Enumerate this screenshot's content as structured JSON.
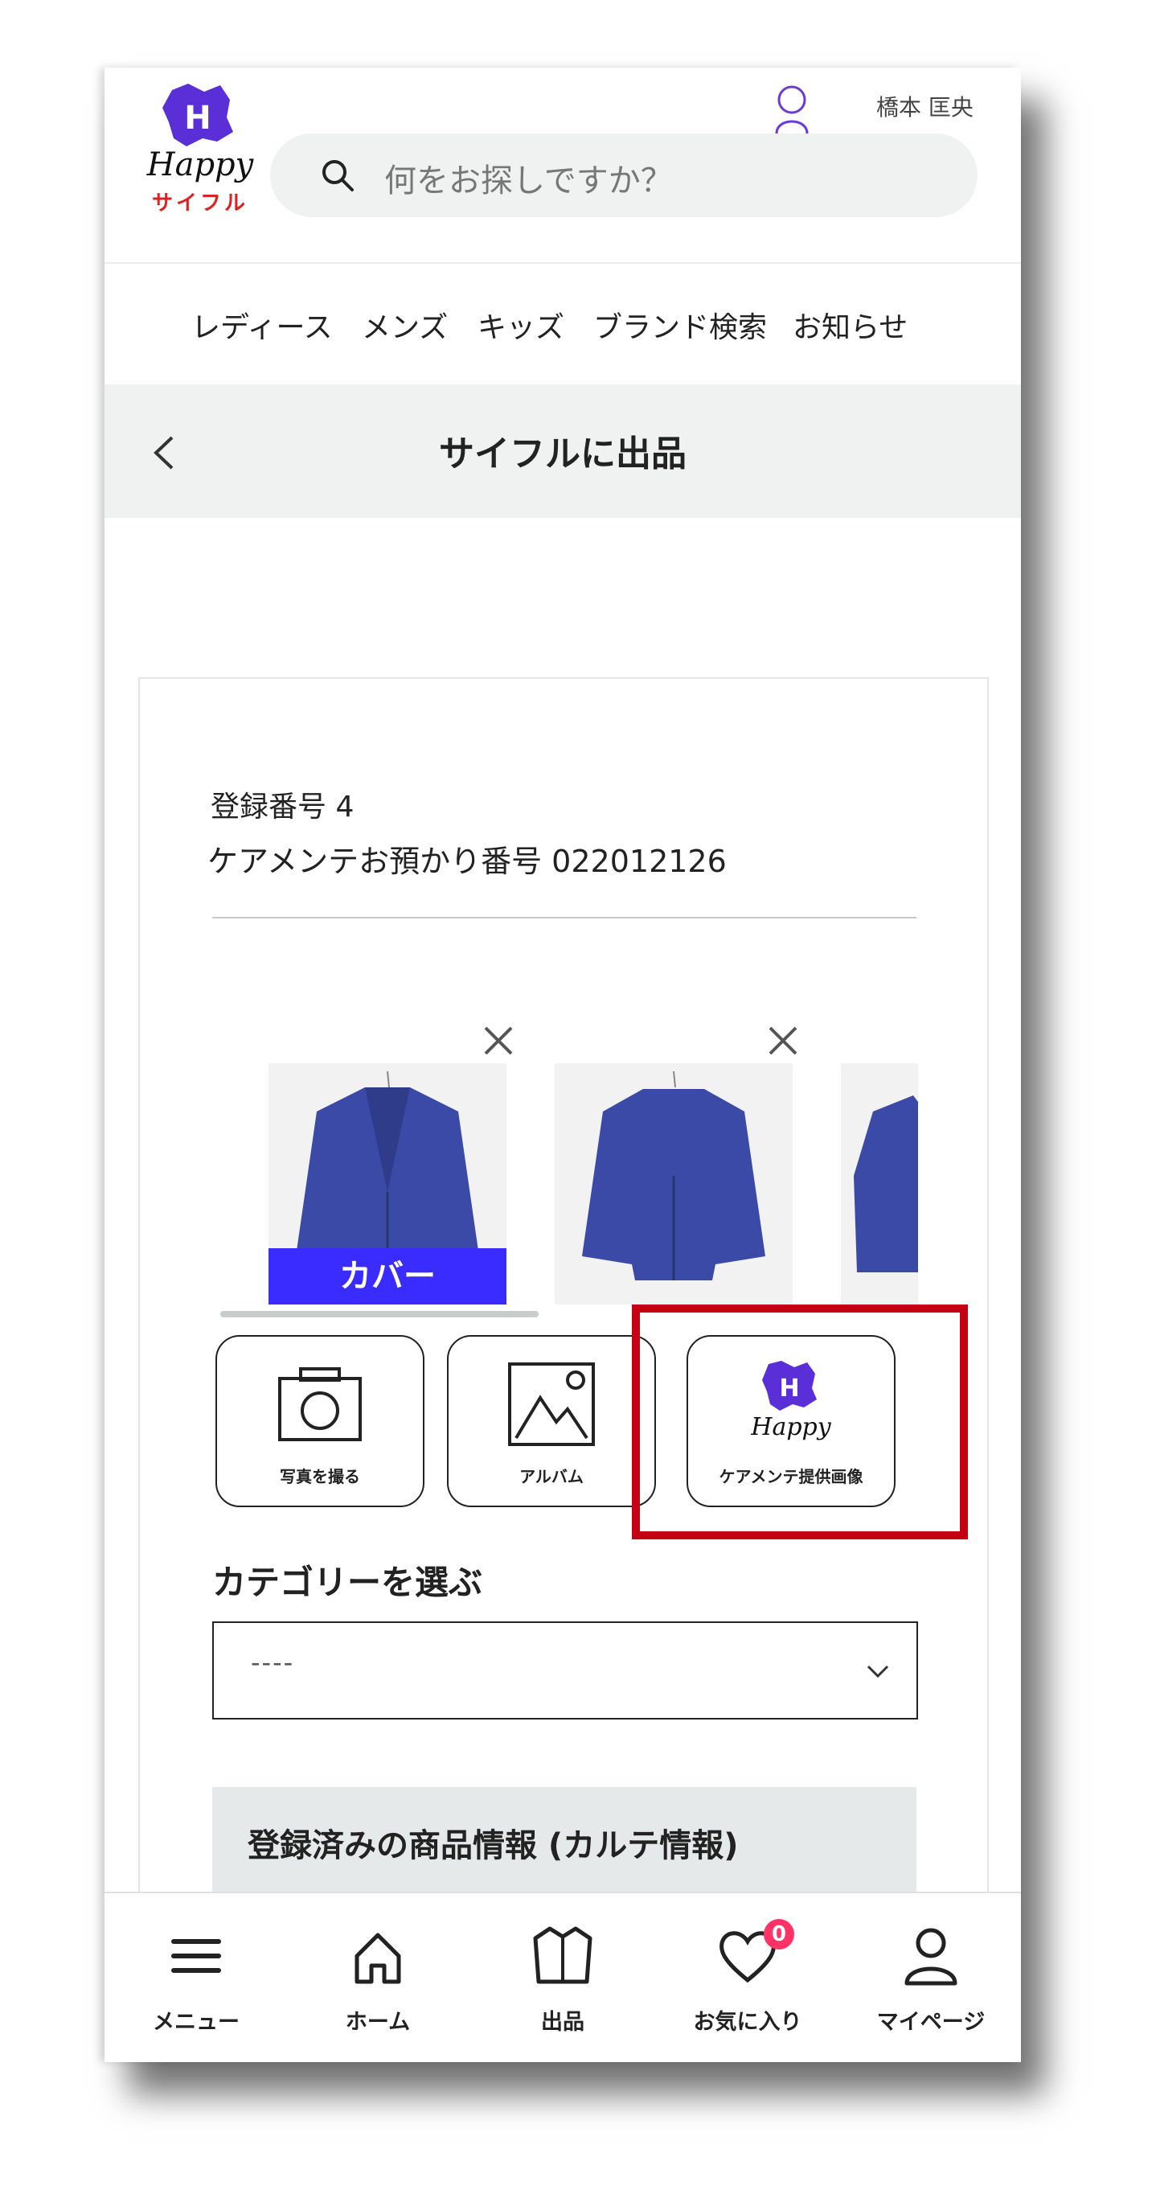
{
  "header": {
    "logo_happy": "Happy",
    "logo_saifuru": "サイフル",
    "user_name": "橋本 匡央",
    "search_placeholder": "何をお探しですか？"
  },
  "nav": {
    "items": [
      "レディース",
      "メンズ",
      "キッズ",
      "ブランド検索",
      "お知らせ"
    ]
  },
  "titlebar": {
    "title": "サイフルに出品"
  },
  "listing": {
    "registration": "登録番号 4",
    "care_number": "ケアメンテお預かり番号 022012126",
    "cover_label": "カバー",
    "buttons": {
      "camera": "写真を撮る",
      "album": "アルバム",
      "caremente": "ケアメンテ提供画像"
    },
    "category_heading": "カテゴリーを選ぶ",
    "category_value": "----",
    "info_heading": "登録済みの商品情報 (カルテ情報)"
  },
  "bottom_nav": {
    "menu": "メニュー",
    "home": "ホーム",
    "sell": "出品",
    "favorites": "お気に入り",
    "favorites_count": "0",
    "mypage": "マイページ"
  },
  "colors": {
    "brand_purple": "#5a2fd8",
    "cover_blue": "#3a2bff",
    "highlight_red": "#c40012",
    "badge_pink": "#ff3366"
  }
}
